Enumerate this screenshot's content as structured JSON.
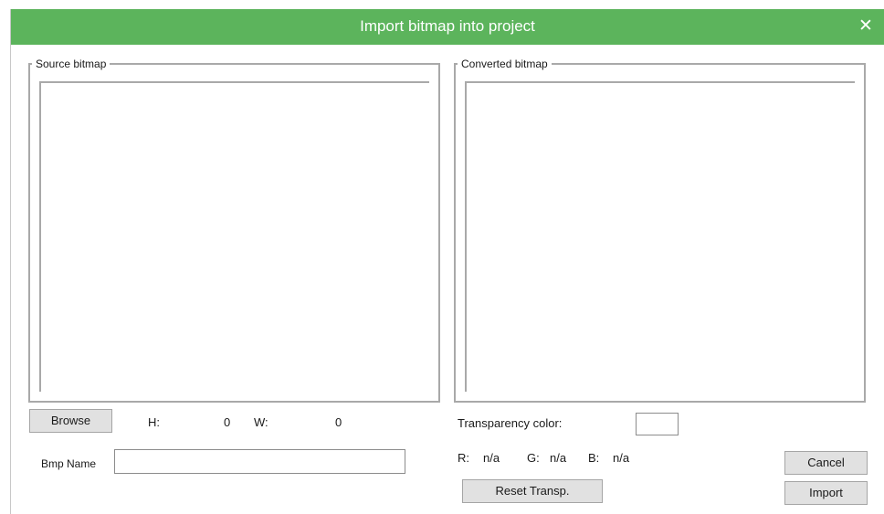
{
  "dialog": {
    "title": "Import bitmap into project",
    "close_glyph": "✕",
    "close_icon": "close-icon",
    "accent_color": "#5cb45c"
  },
  "source": {
    "legend": "Source bitmap",
    "browse_label": "Browse",
    "h_label": "H:",
    "h_value": "0",
    "w_label": "W:",
    "w_value": "0",
    "name_label": "Bmp Name",
    "name_value": ""
  },
  "converted": {
    "legend": "Converted bitmap",
    "transparency_label": "Transparency color:",
    "r_label": "R:",
    "r_value": "n/a",
    "g_label": "G:",
    "g_value": "n/a",
    "b_label": "B:",
    "b_value": "n/a",
    "reset_label": "Reset Transp."
  },
  "actions": {
    "cancel_label": "Cancel",
    "import_label": "Import"
  }
}
